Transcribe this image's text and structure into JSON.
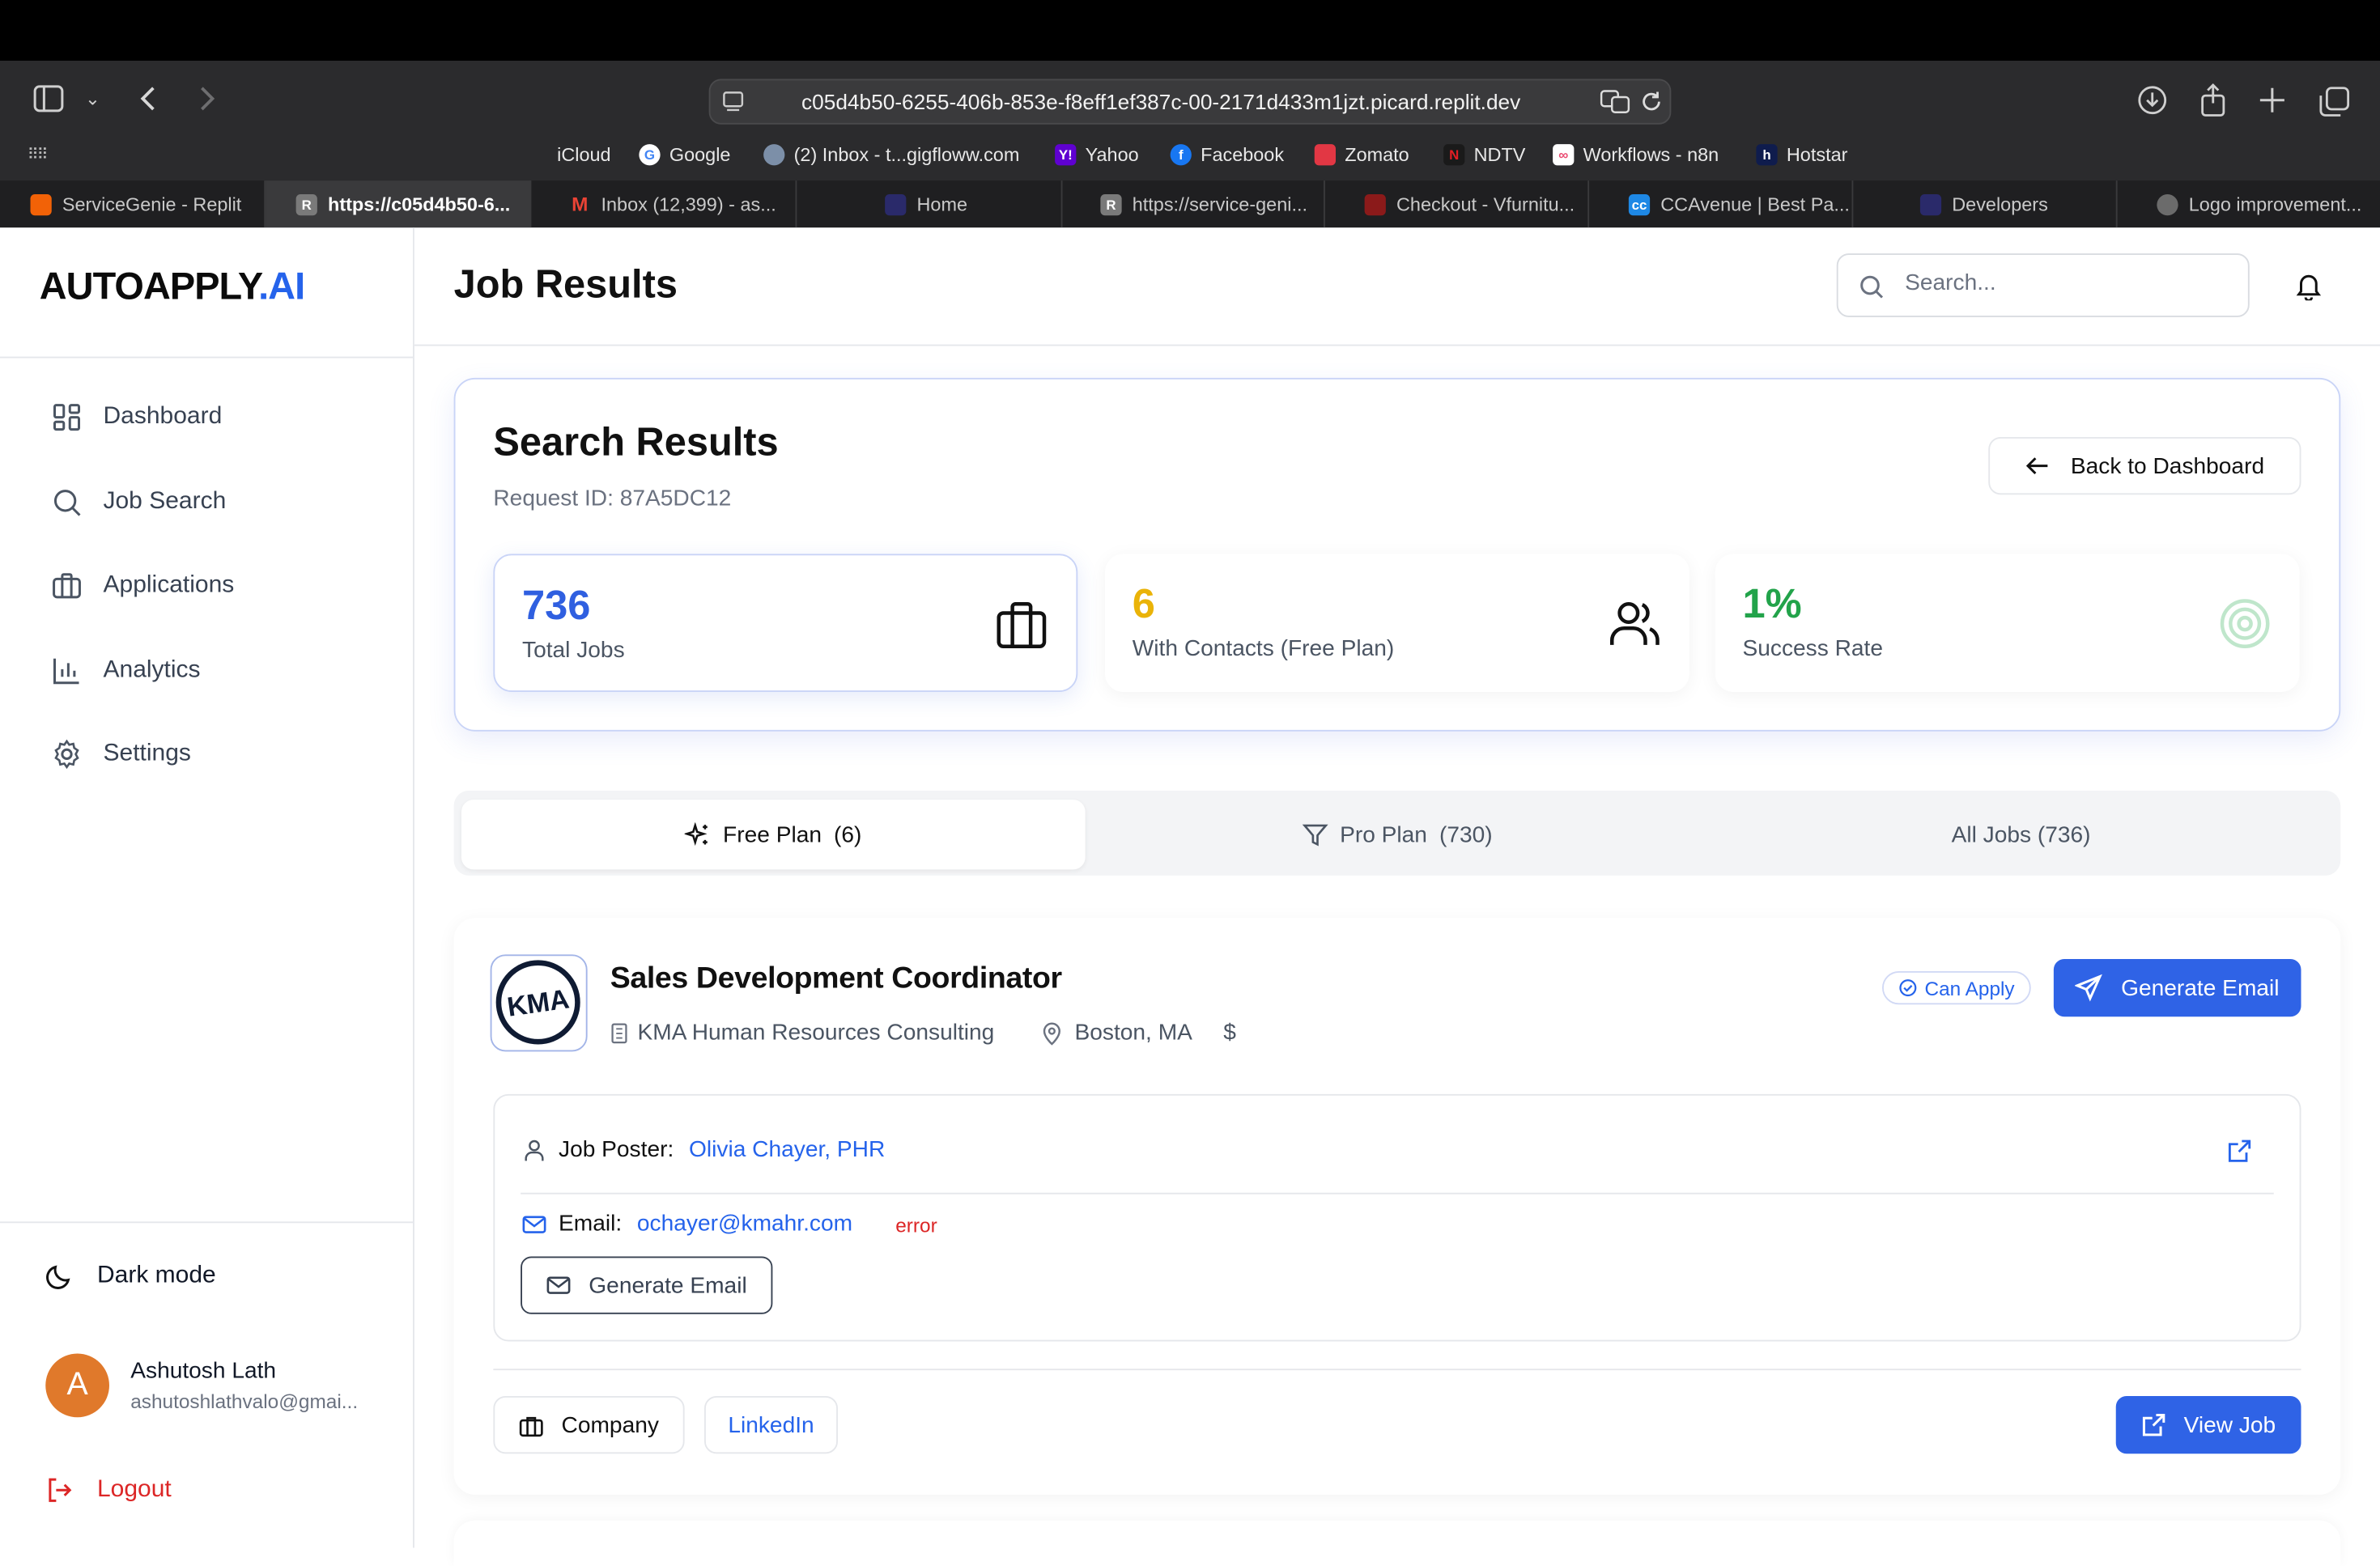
{
  "browser": {
    "url": "c05d4b50-6255-406b-853e-f8eff1ef387c-00-2171d433m1jzt.picard.replit.dev",
    "bookmarks": [
      {
        "label": "iCloud",
        "icon": "apple-icon",
        "color": "#8e8e93"
      },
      {
        "label": "Google",
        "icon": "google-icon",
        "color": "#4285f4"
      },
      {
        "label": "(2) Inbox - t...gigfloww.com",
        "icon": "mail-icon",
        "color": "#7c8fa8"
      },
      {
        "label": "Yahoo",
        "icon": "yahoo-icon",
        "color": "#5f01d1"
      },
      {
        "label": "Facebook",
        "icon": "facebook-icon",
        "color": "#1877f2"
      },
      {
        "label": "Zomato",
        "icon": "zomato-icon",
        "color": "#e23744"
      },
      {
        "label": "NDTV",
        "icon": "ndtv-icon",
        "color": "#e31e24"
      },
      {
        "label": "Workflows - n8n",
        "icon": "n8n-icon",
        "color": "#ea4b71"
      },
      {
        "label": "Hotstar",
        "icon": "hotstar-icon",
        "color": "#0f1c4d"
      }
    ],
    "tabs": [
      {
        "label": "ServiceGenie - Replit",
        "icon": "replit-icon",
        "color": "#f26207",
        "active": false
      },
      {
        "label": "https://c05d4b50-6...",
        "icon": "r-icon",
        "color": "#7a7a7a",
        "active": true
      },
      {
        "label": "Inbox (12,399) - as...",
        "icon": "gmail-icon",
        "color": "#ea4335",
        "active": false
      },
      {
        "label": "Home",
        "icon": "app-icon",
        "color": "#2a2a6a",
        "active": false
      },
      {
        "label": "https://service-geni...",
        "icon": "r-icon",
        "color": "#7a7a7a",
        "active": false
      },
      {
        "label": "Checkout - Vfurnitu...",
        "icon": "shop-icon",
        "color": "#8b1a1a",
        "active": false
      },
      {
        "label": "CCAvenue | Best Pa...",
        "icon": "ccavenue-icon",
        "color": "#1e88e5",
        "active": false
      },
      {
        "label": "Developers",
        "icon": "app-icon",
        "color": "#2a2a6a",
        "active": false
      },
      {
        "label": "Logo improvement...",
        "icon": "openai-icon",
        "color": "#6b6b6b",
        "active": false
      }
    ]
  },
  "sidebar": {
    "logo_main": "AUTOAPPLY",
    "logo_accent": ".AI",
    "nav": [
      {
        "label": "Dashboard",
        "icon": "dashboard-icon"
      },
      {
        "label": "Job Search",
        "icon": "search-icon"
      },
      {
        "label": "Applications",
        "icon": "briefcase-icon"
      },
      {
        "label": "Analytics",
        "icon": "bar-chart-icon"
      },
      {
        "label": "Settings",
        "icon": "gear-icon"
      }
    ],
    "dark_mode_label": "Dark mode",
    "user": {
      "initial": "A",
      "name": "Ashutosh Lath",
      "email": "ashutoshlathvalo@gmai..."
    },
    "logout_label": "Logout"
  },
  "header": {
    "title": "Job Results",
    "search_placeholder": "Search..."
  },
  "results": {
    "title": "Search Results",
    "request_id": "Request ID: 87A5DC12",
    "back_label": "Back to Dashboard",
    "stats": [
      {
        "value": "736",
        "label": "Total Jobs",
        "color": "#2f5fe0",
        "icon": "briefcase-icon"
      },
      {
        "value": "6",
        "label": "With Contacts (Free Plan)",
        "color": "#eab308",
        "icon": "users-icon"
      },
      {
        "value": "1%",
        "label": "Success Rate",
        "color": "#22a34a",
        "icon": "target-icon"
      }
    ]
  },
  "plan_tabs": [
    {
      "label": "Free Plan",
      "count": "(6)",
      "icon": "sparkles-icon",
      "active": true
    },
    {
      "label": "Pro Plan",
      "count": "(730)",
      "icon": "filter-icon",
      "active": false
    },
    {
      "label": "All Jobs (736)",
      "count": "",
      "icon": "",
      "active": false
    }
  ],
  "job": {
    "logo_text": "KMA",
    "title": "Sales Development Coordinator",
    "company": "KMA Human Resources Consulting",
    "location": "Boston, MA",
    "salary": "$",
    "badge": "Can Apply",
    "generate_email_label": "Generate Email",
    "poster_label": "Job Poster:",
    "poster_name": "Olivia Chayer, PHR",
    "email_label": "Email:",
    "email_value": "ochayer@kmahr.com",
    "email_status": "error",
    "generate_email_secondary_label": "Generate Email",
    "company_button_label": "Company",
    "linkedin_label": "LinkedIn",
    "view_job_label": "View Job"
  }
}
